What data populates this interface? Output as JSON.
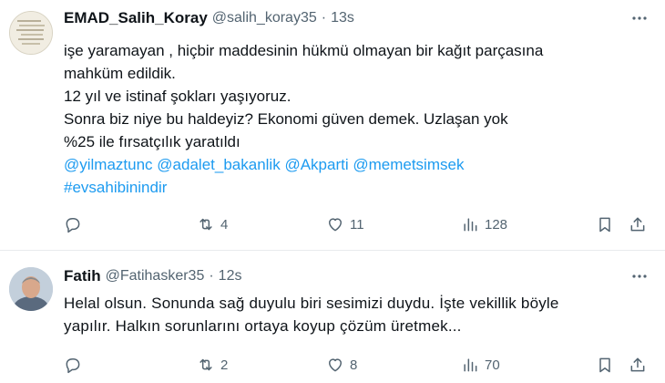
{
  "tweets": [
    {
      "display_name": "EMAD_Salih_Koray",
      "handle": "@salih_koray35",
      "separator": "·",
      "time": "13s",
      "lines": [
        "işe yaramayan , hiçbir maddesinin hükmü olmayan bir kağıt parçasına",
        "mahküm edildik.",
        "12 yıl ve istinaf şokları yaşıyoruz.",
        "Sonra biz niye bu haldeyiz? Ekonomi güven demek. Uzlaşan yok",
        "%25 ile fırsatçılık yaratıldı"
      ],
      "mentions": [
        "@yilmaztunc",
        "@adalet_bakanlik",
        "@Akparti",
        "@memetsimsek"
      ],
      "hashtag": "#evsahibinindir",
      "retweets": "4",
      "likes": "11",
      "views": "128"
    },
    {
      "display_name": "Fatih",
      "handle": "@Fatihasker35",
      "separator": "·",
      "time": "12s",
      "lines": [
        "Helal olsun. Sonunda sağ duyulu biri sesimizi duydu. İşte vekillik böyle",
        "yapılır. Halkın sorunlarını ortaya koyup çözüm üretmek..."
      ],
      "retweets": "2",
      "likes": "8",
      "views": "70"
    }
  ],
  "icons": {
    "more": "more-horizontal-icon",
    "reply": "reply-bubble-icon",
    "retweet": "retweet-icon",
    "like": "heart-icon",
    "views": "views-bar-chart-icon",
    "bookmark": "bookmark-icon",
    "share": "share-upload-icon"
  },
  "colors": {
    "link": "#1d9bf0",
    "text": "#0f1419",
    "secondary": "#536471",
    "divider": "#e8ebed"
  }
}
